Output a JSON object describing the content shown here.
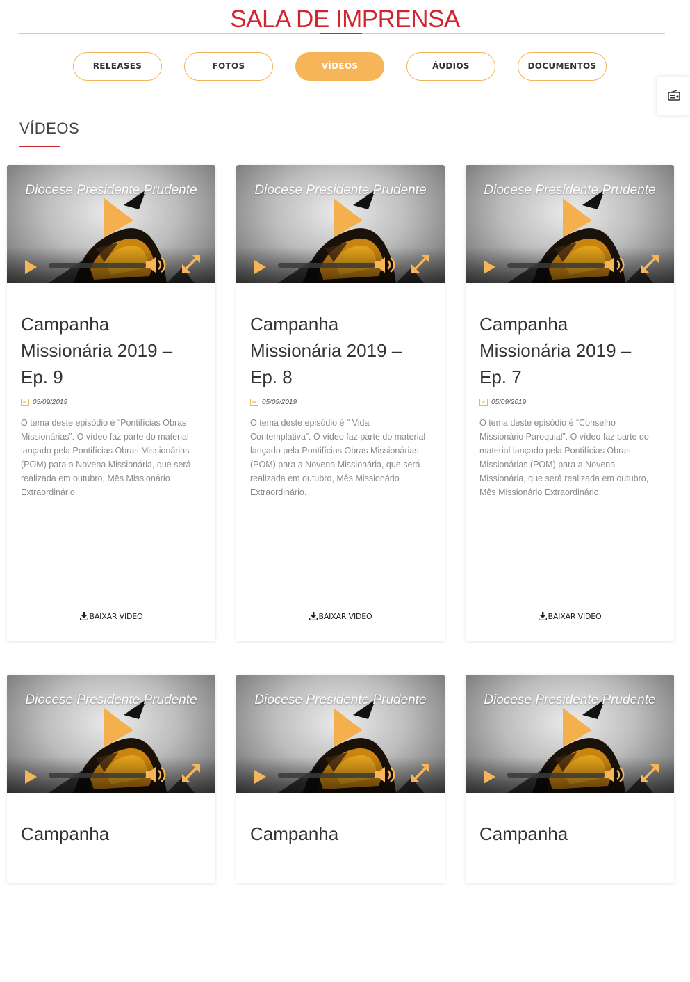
{
  "header": {
    "title": "SALA DE IMPRENSA"
  },
  "tabs": [
    {
      "label": "RELEASES",
      "active": false
    },
    {
      "label": "FOTOS",
      "active": false
    },
    {
      "label": "VÍDEOS",
      "active": true
    },
    {
      "label": "ÁUDIOS",
      "active": false
    },
    {
      "label": "DOCUMENTOS",
      "active": false
    }
  ],
  "section": {
    "title": "VÍDEOS"
  },
  "side_widget": {
    "icon": "radio-icon"
  },
  "video_thumb": {
    "brand": "Diocese Presidente Prudente"
  },
  "cards": [
    {
      "title": "Campanha Missionária 2019 – Ep. 9",
      "date": "05/09/2019",
      "text": "O tema deste episódio é “Pontifícias Obras Missionárias”. O vídeo faz parte do material lançado pela Pontifícias Obras Missionárias (POM) para a Novena Missionária, que será realizada em outubro, Mês Missionário Extraordinário.",
      "download": "BAIXAR VIDEO"
    },
    {
      "title": "Campanha Missionária 2019 – Ep. 8",
      "date": "05/09/2019",
      "text": "O tema deste episódio é ” Vida Contemplativa”. O vídeo faz parte do material lançado pela Pontifícias Obras Missionárias (POM) para a Novena Missionária, que será realizada em outubro, Mês Missionário Extraordinário.",
      "download": "BAIXAR VIDEO"
    },
    {
      "title": "Campanha Missionária 2019 – Ep. 7",
      "date": "05/09/2019",
      "text": "O tema deste episódio é “Conselho Missionário Paroquial”. O vídeo faz parte do material lançado pela Pontifícias Obras Missionárias (POM) para a Novena Missionária, que será realizada em outubro, Mês Missionário Extraordinário.",
      "download": "BAIXAR VIDEO"
    },
    {
      "title": "Campanha",
      "date": "",
      "text": "",
      "download": ""
    },
    {
      "title": "Campanha",
      "date": "",
      "text": "",
      "download": ""
    },
    {
      "title": "Campanha",
      "date": "",
      "text": "",
      "download": ""
    }
  ],
  "colors": {
    "accent": "#d1262f",
    "orange": "#f7b55a"
  }
}
